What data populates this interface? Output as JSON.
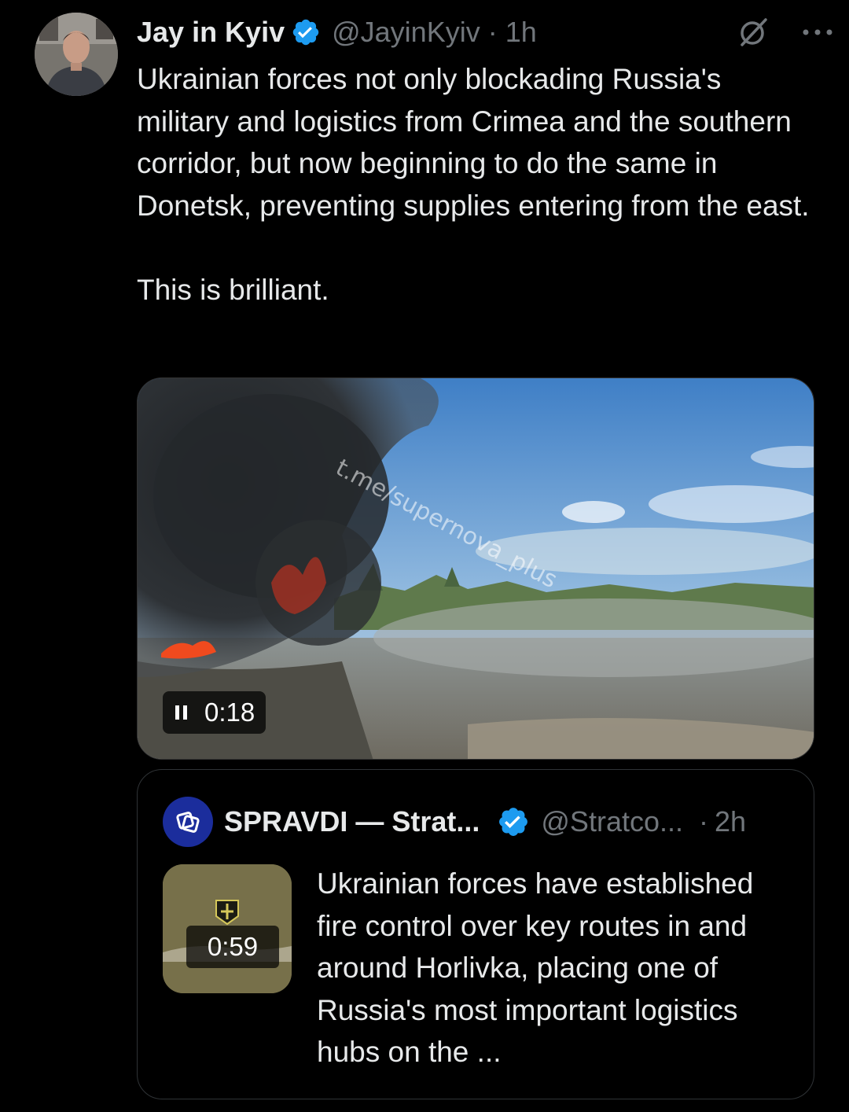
{
  "tweet": {
    "display_name": "Jay in Kyiv",
    "handle": "@JayinKyiv",
    "separator": "·",
    "time": "1h",
    "text": "Ukrainian forces not only blockading Russia's military and logistics from Crimea and the southern corridor, but now beginning to do the same in Donetsk, preventing supplies entering from the east.\n\nThis is brilliant.",
    "video": {
      "timer": "0:18",
      "watermark": "t.me/supernova_plus",
      "state": "playing"
    }
  },
  "quote": {
    "display_name": "SPRAVDI — Strat...",
    "handle": "@Stratco...",
    "separator": "·",
    "time": "2h",
    "video_timer": "0:59",
    "text": "Ukrainian forces have established fire control over key routes in and around Horlivka, placing one of Russia's most important logistics hubs on the ..."
  },
  "colors": {
    "background": "#000000",
    "text_primary": "#e7e9ea",
    "text_secondary": "#71767b",
    "verified_blue": "#1d9bf0",
    "border": "#2f3336"
  },
  "icons": [
    "verified-badge-icon",
    "grok-icon",
    "more-icon",
    "pause-icon",
    "spravdi-logo-icon"
  ]
}
